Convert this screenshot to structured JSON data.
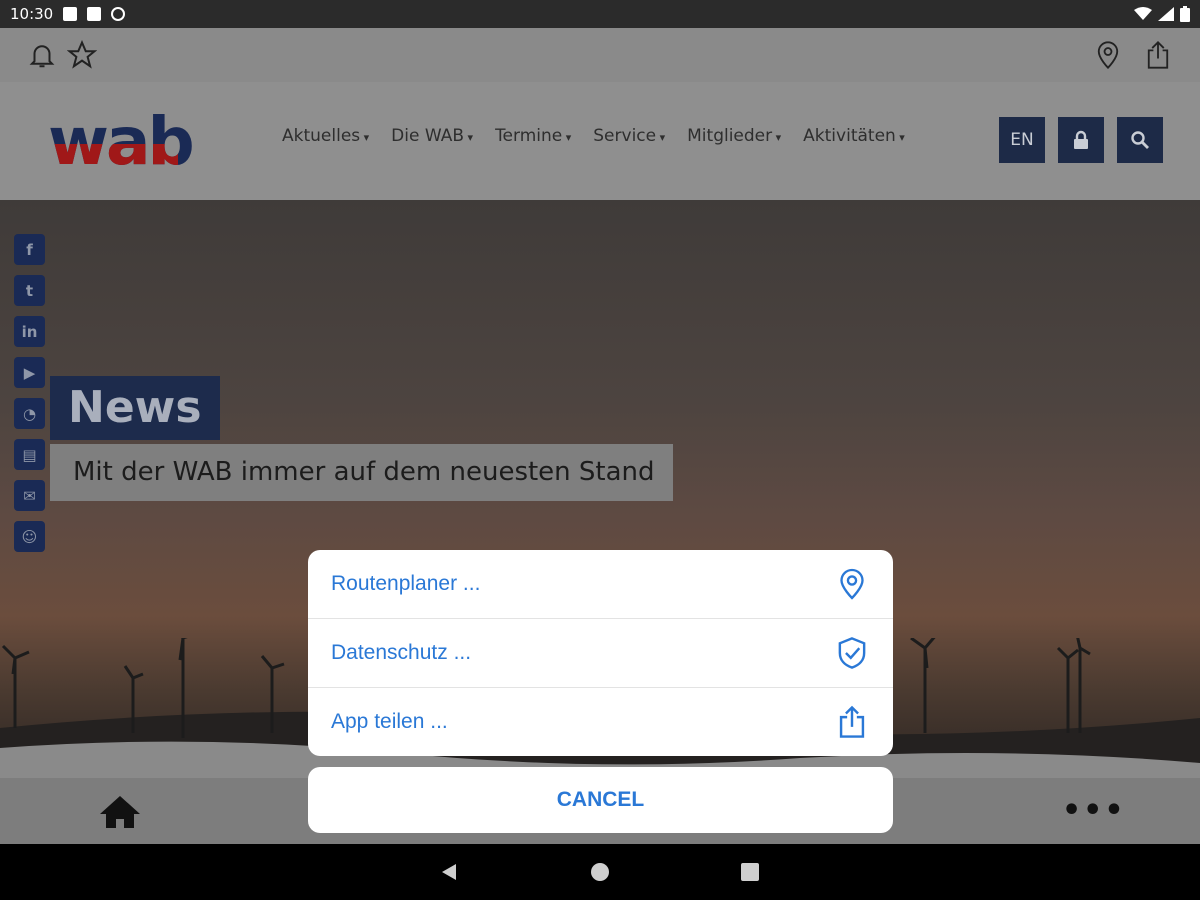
{
  "status_bar": {
    "time": "10:30"
  },
  "site": {
    "logo_text": "wab",
    "nav": [
      "Aktuelles",
      "Die WAB",
      "Termine",
      "Service",
      "Mitglieder",
      "Aktivitäten"
    ],
    "lang_button": "EN"
  },
  "hero": {
    "title": "News",
    "subtitle": "Mit der WAB immer auf dem neuesten Stand"
  },
  "action_sheet": {
    "items": [
      {
        "label": "Routenplaner ...",
        "icon": "location-pin-icon"
      },
      {
        "label": "Datenschutz ...",
        "icon": "shield-check-icon"
      },
      {
        "label": "App teilen ...",
        "icon": "share-icon"
      }
    ],
    "cancel_label": "CANCEL"
  },
  "colors": {
    "accent": "#2a78d6",
    "brand_navy": "#1a2a55",
    "brand_red": "#a01818"
  }
}
